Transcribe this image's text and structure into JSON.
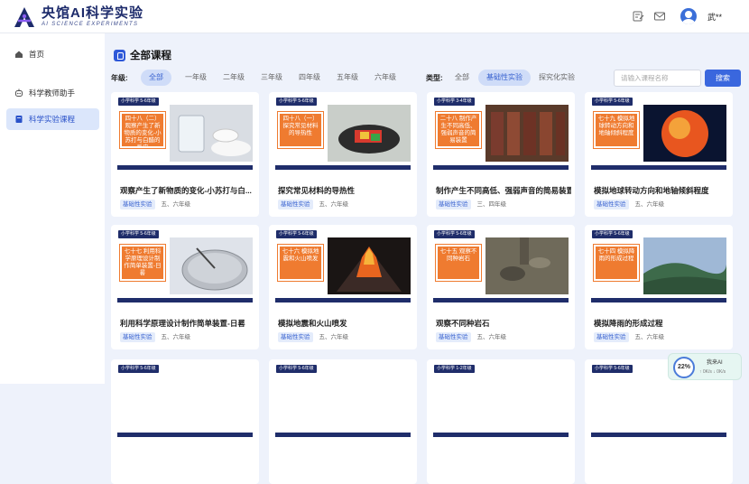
{
  "app": {
    "logo_title": "央馆AI科学实验",
    "logo_subtitle": "AI SCIENCE EXPERIMENTS",
    "user_name": "武**"
  },
  "sidebar": {
    "items": [
      {
        "label": "首页",
        "icon": "home-icon",
        "active": false
      },
      {
        "label": "科学教师助手",
        "icon": "robot-icon",
        "active": false
      },
      {
        "label": "科学实验课程",
        "icon": "book-icon",
        "active": true
      }
    ]
  },
  "main": {
    "title": "全部课程",
    "grade_label": "年级:",
    "grades": [
      "全部",
      "一年级",
      "二年级",
      "三年级",
      "四年级",
      "五年级",
      "六年级"
    ],
    "grade_selected": "全部",
    "type_label": "类型:",
    "types": [
      "全部",
      "基础性实验",
      "探究化实验"
    ],
    "type_selected": "基础性实验",
    "search_placeholder": "请输入课程名称",
    "search_button": "搜索"
  },
  "courses": [
    {
      "grade_tag": "小学科学 5-6年级",
      "cover_text": "四十八（二）观察产生了新物质的变化-小苏打与白醋的反应",
      "title": "观察产生了新物质的变化-小苏打与白...",
      "type": "基础性实验",
      "grade": "五、六年级"
    },
    {
      "grade_tag": "小学科学 5-6年级",
      "cover_text": "四十八（一）探究常见材料的导热性",
      "title": "探究常见材料的导热性",
      "type": "基础性实验",
      "grade": "五、六年级"
    },
    {
      "grade_tag": "小学科学 3-4年级",
      "cover_text": "二十八 制作产生不同高低、强弱声音的简易装置",
      "title": "制作产生不同高低、强弱声音的简易装置",
      "type": "基础性实验",
      "grade": "三、四年级"
    },
    {
      "grade_tag": "小学科学 5-6年级",
      "cover_text": "七十九 模拟地球转动方向和地轴倾斜程度",
      "title": "模拟地球转动方向和地轴倾斜程度",
      "type": "基础性实验",
      "grade": "五、六年级"
    },
    {
      "grade_tag": "小学科学 5-6年级",
      "cover_text": "七十七 利用科学原理设计制作简单装置-日晷",
      "title": "利用科学原理设计制作简单装置-日晷",
      "type": "基础性实验",
      "grade": "五、六年级"
    },
    {
      "grade_tag": "小学科学 5-6年级",
      "cover_text": "七十六 模拟地震和火山喷发",
      "title": "模拟地震和火山喷发",
      "type": "基础性实验",
      "grade": "五、六年级"
    },
    {
      "grade_tag": "小学科学 5-6年级",
      "cover_text": "七十五 观察不同种岩石",
      "title": "观察不同种岩石",
      "type": "基础性实验",
      "grade": "五、六年级"
    },
    {
      "grade_tag": "小学科学 5-6年级",
      "cover_text": "七十四 模拟降雨的形成过程",
      "title": "模拟降雨的形成过程",
      "type": "基础性实验",
      "grade": "五、六年级"
    },
    {
      "grade_tag": "小学科学 5-6年级",
      "cover_text": "",
      "title": "",
      "type": "",
      "grade": ""
    },
    {
      "grade_tag": "小学科学 5-6年级",
      "cover_text": "",
      "title": "",
      "type": "",
      "grade": ""
    },
    {
      "grade_tag": "小学科学 1-2年级",
      "cover_text": "",
      "title": "",
      "type": "",
      "grade": ""
    },
    {
      "grade_tag": "小学科学 5-6年级",
      "cover_text": "",
      "title": "",
      "type": "",
      "grade": ""
    }
  ],
  "widget": {
    "percent": "22%",
    "label": "我来AI",
    "stats": "↑ 0K/s   ↓ 0K/s"
  },
  "colors": {
    "accent": "#3a67de",
    "navy": "#1f2d6a",
    "orange": "#ef7b30",
    "background": "#eef2fb"
  }
}
